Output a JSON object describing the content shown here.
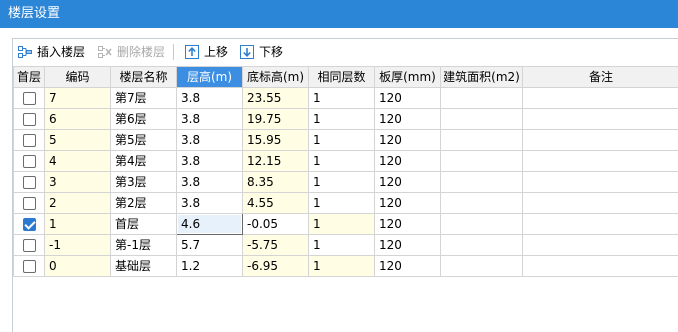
{
  "window": {
    "title": "楼层设置"
  },
  "toolbar": {
    "insert_label": "插入楼层",
    "delete_label": "删除楼层",
    "up_label": "上移",
    "down_label": "下移"
  },
  "table": {
    "columns": [
      "首层",
      "编码",
      "楼层名称",
      "层高(m)",
      "底标高(m)",
      "相同层数",
      "板厚(mm)",
      "建筑面积(m2)",
      "备注"
    ],
    "selected_column": "层高(m)",
    "rows": [
      {
        "is_first": false,
        "code": "7",
        "name": "第7层",
        "height": "3.8",
        "bottom_elev": "23.55",
        "same_count": "1",
        "slab": "120",
        "area": "",
        "note": ""
      },
      {
        "is_first": false,
        "code": "6",
        "name": "第6层",
        "height": "3.8",
        "bottom_elev": "19.75",
        "same_count": "1",
        "slab": "120",
        "area": "",
        "note": ""
      },
      {
        "is_first": false,
        "code": "5",
        "name": "第5层",
        "height": "3.8",
        "bottom_elev": "15.95",
        "same_count": "1",
        "slab": "120",
        "area": "",
        "note": ""
      },
      {
        "is_first": false,
        "code": "4",
        "name": "第4层",
        "height": "3.8",
        "bottom_elev": "12.15",
        "same_count": "1",
        "slab": "120",
        "area": "",
        "note": ""
      },
      {
        "is_first": false,
        "code": "3",
        "name": "第3层",
        "height": "3.8",
        "bottom_elev": "8.35",
        "same_count": "1",
        "slab": "120",
        "area": "",
        "note": ""
      },
      {
        "is_first": false,
        "code": "2",
        "name": "第2层",
        "height": "3.8",
        "bottom_elev": "4.55",
        "same_count": "1",
        "slab": "120",
        "area": "",
        "note": ""
      },
      {
        "is_first": true,
        "code": "1",
        "name": "首层",
        "height": "4.6",
        "bottom_elev": "-0.05",
        "same_count": "1",
        "slab": "120",
        "area": "",
        "note": ""
      },
      {
        "is_first": false,
        "code": "-1",
        "name": "第-1层",
        "height": "5.7",
        "bottom_elev": "-5.75",
        "same_count": "1",
        "slab": "120",
        "area": "",
        "note": ""
      },
      {
        "is_first": false,
        "code": "0",
        "name": "基础层",
        "height": "1.2",
        "bottom_elev": "-6.95",
        "same_count": "1",
        "slab": "120",
        "area": "",
        "note": ""
      }
    ]
  },
  "colors": {
    "titlebar": "#2b86d8",
    "header_selected": "#3b8ee2",
    "highlight_cell": "#fffde4",
    "edit_cell": "#e6f1fc",
    "checkbox_checked": "#2a7ad0"
  },
  "icons": {
    "insert": "insert-floor-icon",
    "delete": "delete-floor-icon",
    "up": "move-up-icon",
    "down": "move-down-icon"
  }
}
